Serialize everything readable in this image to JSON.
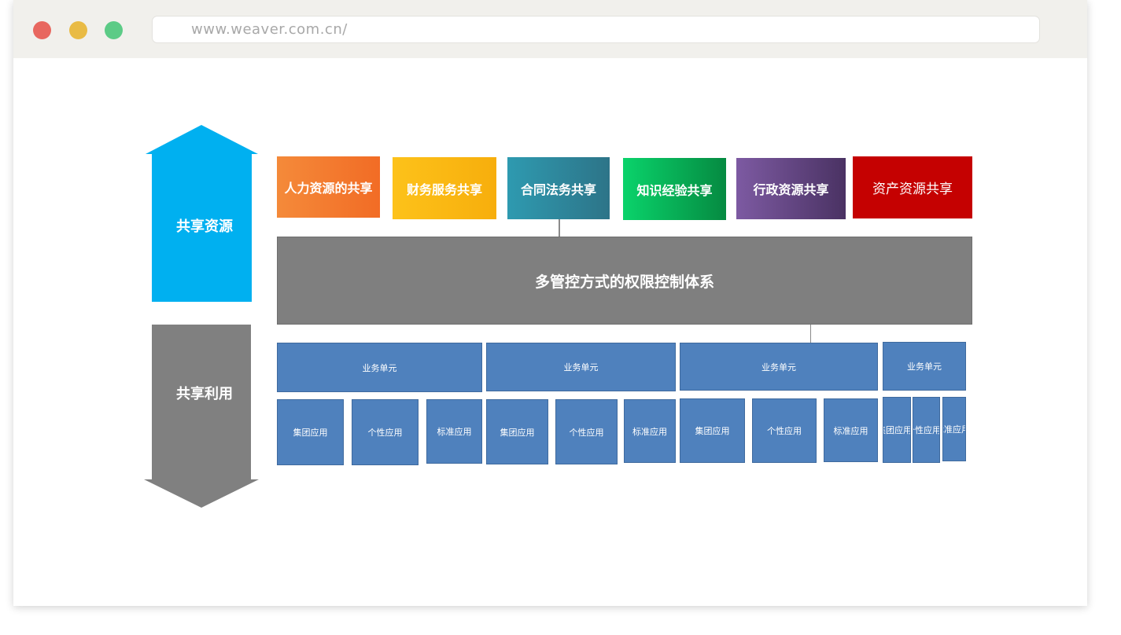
{
  "browser": {
    "url": "www.weaver.com.cn/"
  },
  "diagram": {
    "up_arrow_label": "共享资源",
    "down_arrow_label": "共享利用",
    "top_boxes": [
      {
        "label": "人力资源的共享",
        "color": "#f47a32"
      },
      {
        "label": "财务服务共享",
        "color": "#fcb914"
      },
      {
        "label": "合同法务共享",
        "color": "#2f8ea3"
      },
      {
        "label": "知识经验共享",
        "color": "#07c25e"
      },
      {
        "label": "行政资源共享",
        "color": "#6f4f8f"
      },
      {
        "label": "资产资源共享",
        "color": "#c50b0b"
      }
    ],
    "control_system": "多管控方式的权限控制体系",
    "business_units": [
      "业务单元",
      "业务单元",
      "业务单元",
      "业务单元"
    ],
    "apps": [
      "集团应用",
      "个性应用",
      "标准应用",
      "集团应用",
      "个性应用",
      "标准应用",
      "集团应用",
      "个性应用",
      "标准应用",
      "集团应用",
      "个性应用",
      "标准应用"
    ],
    "colors": {
      "up_arrow": "#00b0f0",
      "down_arrow": "#808080",
      "control_bar": "#7f7f7f",
      "unit_blue": "#4f81bd"
    }
  }
}
